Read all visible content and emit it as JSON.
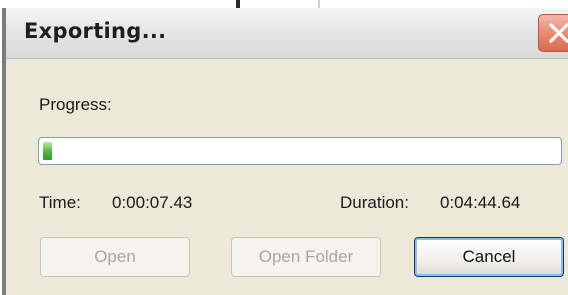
{
  "dialog": {
    "title": "Exporting...",
    "close_icon": "close-icon"
  },
  "progress": {
    "label": "Progress:",
    "fraction": 0.018
  },
  "time": {
    "label": "Time:",
    "value": "0:00:07.43"
  },
  "duration": {
    "label": "Duration:",
    "value": "0:04:44.64"
  },
  "buttons": {
    "open": "Open",
    "open_folder": "Open Folder",
    "cancel": "Cancel"
  },
  "colors": {
    "close_button": "#e88b73",
    "progress_fill": "#57b845",
    "default_button_border": "#003c74"
  }
}
